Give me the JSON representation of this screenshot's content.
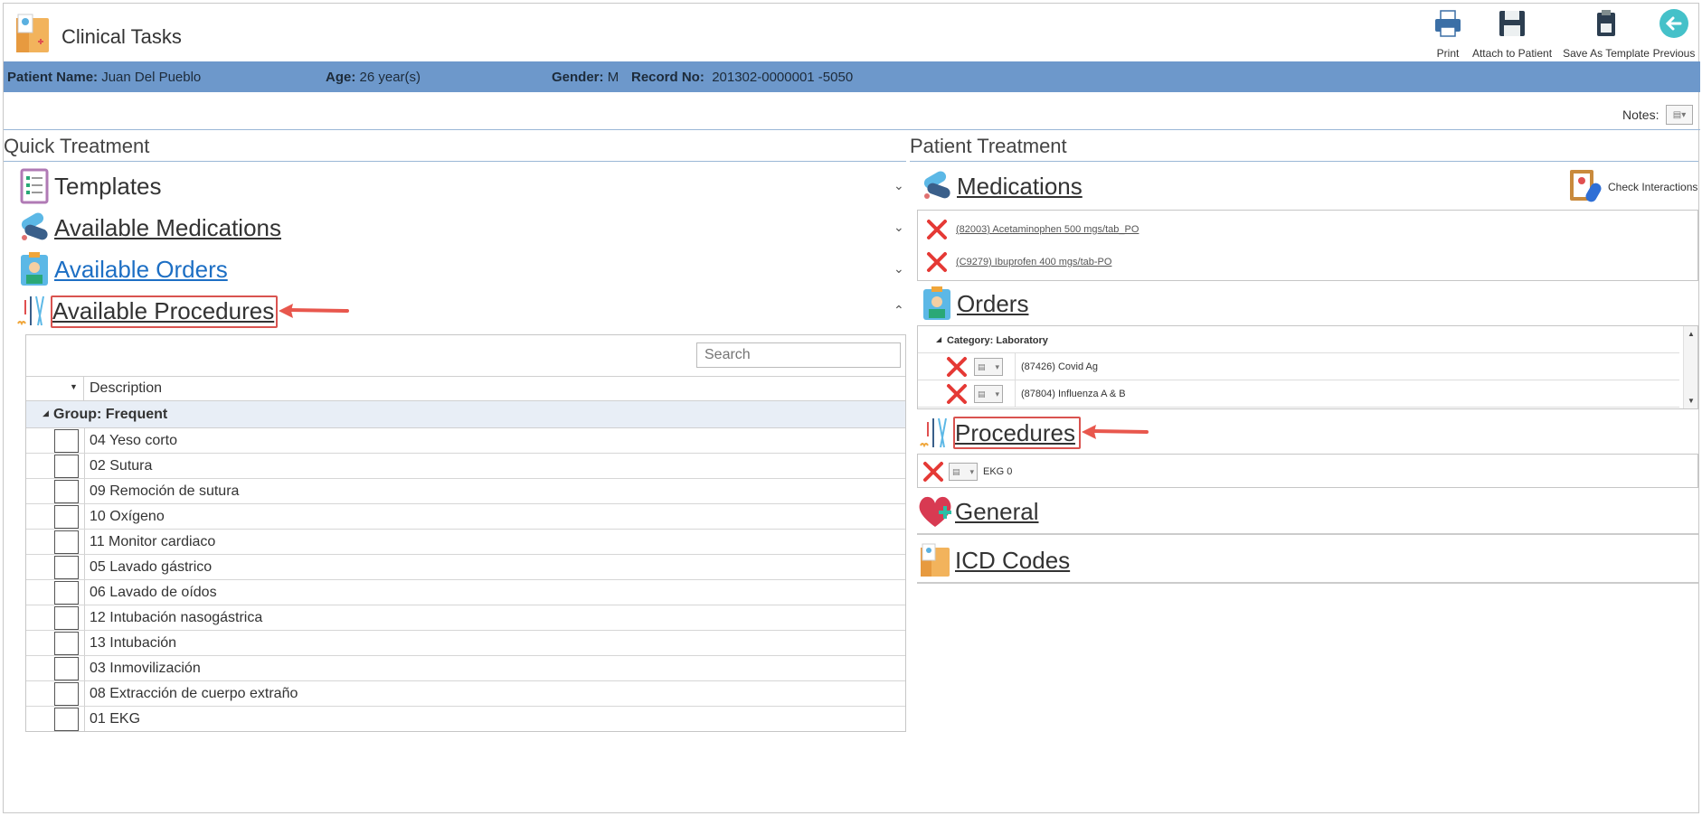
{
  "header": {
    "title": "Clinical Tasks",
    "toolbar": {
      "print": "Print",
      "attach": "Attach to Patient",
      "save_template": "Save As Template",
      "previous": "Previous"
    }
  },
  "patient": {
    "name_label": "Patient Name:",
    "name": "Juan Del Pueblo",
    "age_label": "Age:",
    "age": "26 year(s)",
    "gender_label": "Gender:",
    "gender": "M",
    "record_label": "Record No:",
    "record": "201302-0000001 -5050"
  },
  "notes": {
    "label": "Notes:"
  },
  "quick_treatment": {
    "title": "Quick Treatment",
    "sections": {
      "templates": "Templates",
      "medications": "Available Medications",
      "orders": "Available Orders",
      "procedures": "Available Procedures"
    },
    "grid": {
      "search_placeholder": "Search",
      "column_description": "Description",
      "group": "Group: Frequent",
      "rows": [
        "04 Yeso corto",
        "02 Sutura",
        "09 Remoción de sutura",
        "10 Oxígeno",
        "11 Monitor cardiaco",
        "05 Lavado gástrico",
        "06 Lavado de oídos",
        "12 Intubación nasogástrica",
        "13 Intubación",
        "03 Inmovilización",
        "08 Extracción de cuerpo extraño",
        "01 EKG"
      ]
    }
  },
  "patient_treatment": {
    "title": "Patient Treatment",
    "medications_title": "Medications",
    "check_interactions": "Check Interactions",
    "medications": [
      "(82003) Acetaminophen 500 mgs/tab_PO",
      "(C9279) Ibuprofen 400 mgs/tab-PO"
    ],
    "orders_title": "Orders",
    "orders_category": "Category: Laboratory",
    "orders": [
      "(87426) Covid Ag",
      "(87804) Influenza A & B"
    ],
    "procedures_title": "Procedures",
    "procedures": [
      "EKG 0"
    ],
    "general_title": "General",
    "icd_title": "ICD Codes"
  },
  "colors": {
    "patient_bar": "#6d98cb",
    "link_blue": "#1d6fc4",
    "highlight_red": "#d9534f",
    "delete_red": "#e53935"
  }
}
